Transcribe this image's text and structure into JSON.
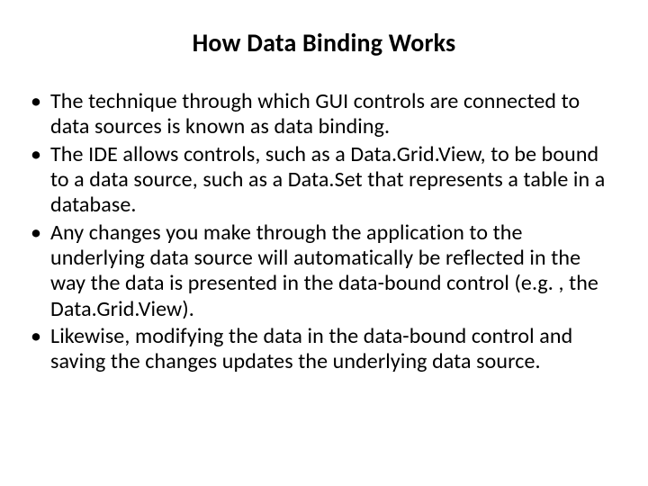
{
  "title": "How Data Binding Works",
  "bullets": [
    "The technique through which GUI controls are connected to data sources is known as data binding.",
    "The IDE allows controls, such as a Data.Grid.View, to be bound to a data source, such as a Data.Set that represents a table in a database.",
    "Any changes you make through the application to the underlying data source will automatically be reflected in the way the data is presented in the data-bound control (e.g. , the Data.Grid.View).",
    "Likewise, modifying the data in the data-bound control and saving the changes updates the underlying data source."
  ]
}
